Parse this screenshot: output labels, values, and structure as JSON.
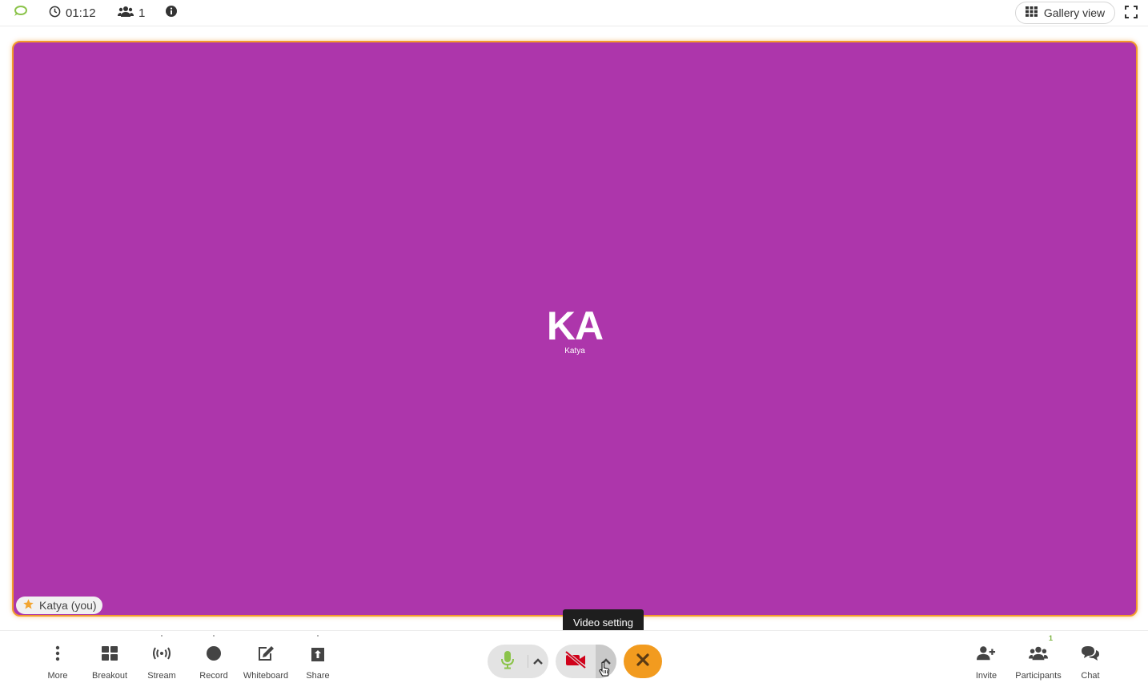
{
  "topbar": {
    "timer": "01:12",
    "participant_count": "1",
    "gallery_label": "Gallery view"
  },
  "stage": {
    "initials": "KA",
    "display_name": "Katya",
    "badge_label": "Katya (you)",
    "background_color": "#ad36ab",
    "highlight_color": "#f29b2b"
  },
  "tooltip": {
    "text": "Video setting"
  },
  "toolbar": {
    "left_tools": [
      {
        "label": "More",
        "icon": "more-vertical-icon"
      },
      {
        "label": "Breakout",
        "icon": "grid-icon"
      },
      {
        "label": "Stream",
        "icon": "broadcast-icon"
      },
      {
        "label": "Record",
        "icon": "record-icon"
      },
      {
        "label": "Whiteboard",
        "icon": "edit-icon"
      },
      {
        "label": "Share",
        "icon": "share-upload-icon"
      }
    ],
    "right_tools": [
      {
        "label": "Invite",
        "icon": "add-user-icon"
      },
      {
        "label": "Participants",
        "icon": "users-icon",
        "badge": "1"
      },
      {
        "label": "Chat",
        "icon": "chat-icon"
      }
    ],
    "colors": {
      "mic": "#8bc34a",
      "camera_off": "#d0021b",
      "leave": "#f29b1f"
    }
  }
}
